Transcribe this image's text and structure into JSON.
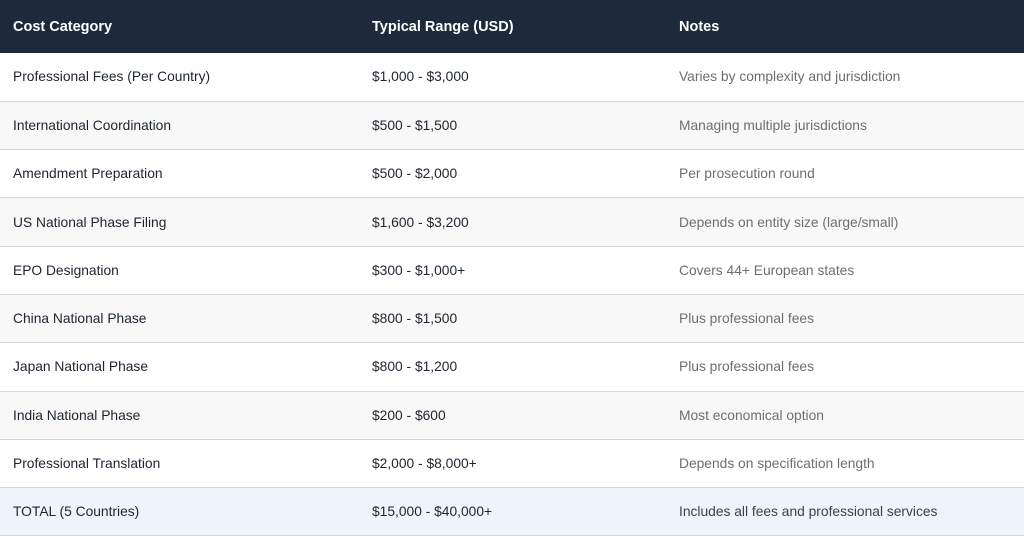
{
  "header": {
    "category": "Cost Category",
    "range": "Typical Range (USD)",
    "notes": "Notes"
  },
  "rows": [
    {
      "category": "Professional Fees (Per Country)",
      "range": "$1,000 - $3,000",
      "notes": "Varies by complexity and jurisdiction"
    },
    {
      "category": "International Coordination",
      "range": "$500 - $1,500",
      "notes": "Managing multiple jurisdictions"
    },
    {
      "category": "Amendment Preparation",
      "range": "$500 - $2,000",
      "notes": "Per prosecution round"
    },
    {
      "category": "US National Phase Filing",
      "range": "$1,600 - $3,200",
      "notes": "Depends on entity size (large/small)"
    },
    {
      "category": "EPO Designation",
      "range": "$300 - $1,000+",
      "notes": "Covers 44+ European states"
    },
    {
      "category": "China National Phase",
      "range": "$800 - $1,500",
      "notes": "Plus professional fees"
    },
    {
      "category": "Japan National Phase",
      "range": "$800 - $1,200",
      "notes": "Plus professional fees"
    },
    {
      "category": "India National Phase",
      "range": "$200 - $600",
      "notes": "Most economical option"
    },
    {
      "category": "Professional Translation",
      "range": "$2,000 - $8,000+",
      "notes": "Depends on specification length"
    }
  ],
  "total": {
    "category": "TOTAL (5 Countries)",
    "range": "$15,000 - $40,000+",
    "notes": "Includes all fees and professional services"
  }
}
